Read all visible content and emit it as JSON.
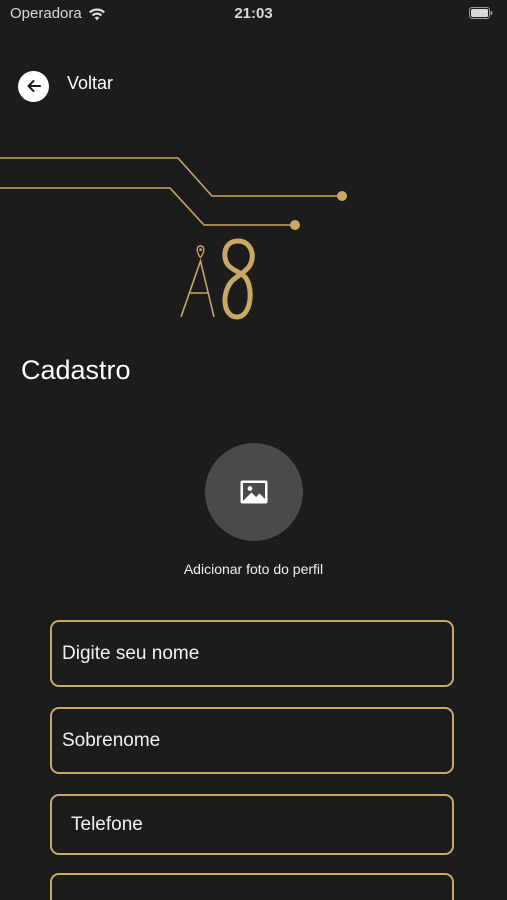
{
  "status_bar": {
    "carrier": "Operadora",
    "time": "21:03"
  },
  "nav": {
    "back_label": "Voltar"
  },
  "page": {
    "title": "Cadastro"
  },
  "profile_photo": {
    "caption": "Adicionar foto do perfil"
  },
  "form": {
    "fields": [
      {
        "placeholder": "Digite seu nome",
        "value": ""
      },
      {
        "placeholder": "Sobrenome",
        "value": ""
      },
      {
        "placeholder": "Telefone",
        "value": ""
      },
      {
        "placeholder": "",
        "value": ""
      }
    ]
  },
  "colors": {
    "background": "#1c1c1c",
    "accent_gold": "#c9a866",
    "avatar_bg": "#4a4a4a",
    "text": "#ffffff"
  },
  "icons": {
    "back": "arrow-left-icon",
    "wifi": "wifi-icon",
    "battery": "battery-icon",
    "photo": "image-icon"
  }
}
